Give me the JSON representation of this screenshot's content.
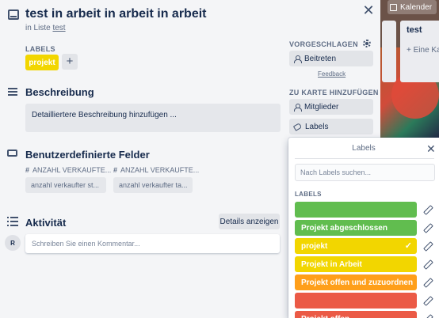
{
  "board": {
    "calendar_label": "Kalender",
    "list_title": "test",
    "list_add": "+ Eine Ka"
  },
  "card": {
    "title": "test in arbeit in arbeit in arbeit",
    "in_list_prefix": "in Liste",
    "list_name": "test",
    "close_symbol": "✕",
    "labels_heading": "LABELS",
    "labels": [
      {
        "text": "projekt",
        "color": "#f2d600"
      }
    ],
    "add_label_symbol": "+",
    "description": {
      "title": "Beschreibung",
      "placeholder": "Detailliertere Beschreibung hinzufügen ..."
    },
    "custom_fields": {
      "title": "Benutzerdefinierte Felder",
      "fields": [
        {
          "label": "ANZAHL VERKAUFTE...",
          "placeholder": "anzahl verkaufter st..."
        },
        {
          "label": "ANZAHL VERKAUFTE...",
          "placeholder": "anzahl verkaufter ta..."
        }
      ]
    },
    "activity": {
      "title": "Aktivität",
      "details_button": "Details anzeigen",
      "avatar_initial": "R",
      "comment_placeholder": "Schreiben Sie einen Kommentar..."
    }
  },
  "sidebar": {
    "suggested_heading": "VORGESCHLAGEN",
    "join_button": "Beitreten",
    "feedback_link": "Feedback",
    "add_heading": "ZU KARTE HINZUFÜGEN",
    "members_button": "Mitglieder",
    "labels_button": "Labels"
  },
  "labels_popover": {
    "title": "Labels",
    "close_symbol": "✕",
    "search_placeholder": "Nach Labels suchen...",
    "section_heading": "LABELS",
    "items": [
      {
        "text": "",
        "color": "#61bd4f",
        "checked": false
      },
      {
        "text": "Projekt abgeschlossen",
        "color": "#61bd4f",
        "checked": false
      },
      {
        "text": "projekt",
        "color": "#f2d600",
        "checked": true
      },
      {
        "text": "Projekt in Arbeit",
        "color": "#f2d600",
        "checked": false
      },
      {
        "text": "Projekt offen und zuzuordnen",
        "color": "#ff9f1a",
        "checked": false
      },
      {
        "text": "",
        "color": "#eb5a46",
        "checked": false
      },
      {
        "text": "Projekt offen",
        "color": "#eb5a46",
        "checked": false
      }
    ],
    "check_symbol": "✓"
  }
}
